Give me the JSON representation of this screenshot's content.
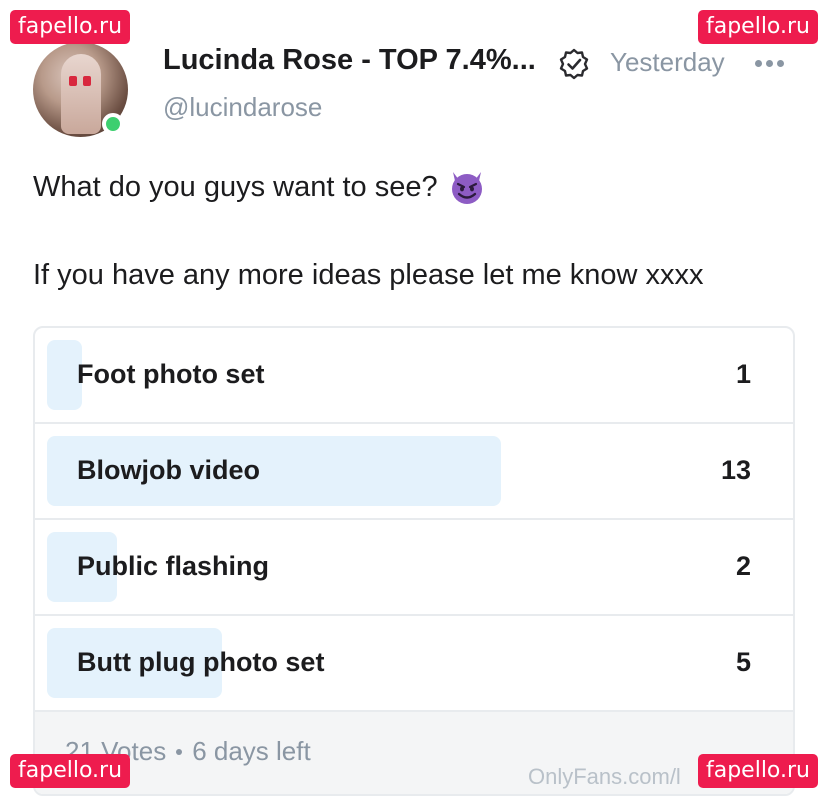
{
  "watermark": "fapello.ru",
  "post": {
    "author_name": "Lucinda Rose - TOP 7.4%...",
    "handle": "@lucindarose",
    "time": "Yesterday",
    "text_line1": "What do you guys want to see?",
    "text_line2": "If you have any more ideas please let me know xxxx",
    "emoji": "smiling-devil-emoji"
  },
  "poll": {
    "options": [
      {
        "label": "Foot photo set",
        "count": "1",
        "votes": 1
      },
      {
        "label": "Blowjob video",
        "count": "13",
        "votes": 13
      },
      {
        "label": "Public flashing",
        "count": "2",
        "votes": 2
      },
      {
        "label": "Butt plug photo set",
        "count": "5",
        "votes": 5
      }
    ],
    "votes_text": "21 Votes",
    "time_left": "6 days left"
  },
  "site_mark": "OnlyFans.com/l",
  "colors": {
    "watermark": "#ee1c4e",
    "poll_bar": "#e4f2fc",
    "online": "#3dcf6f",
    "muted_text": "#8a96a3"
  }
}
